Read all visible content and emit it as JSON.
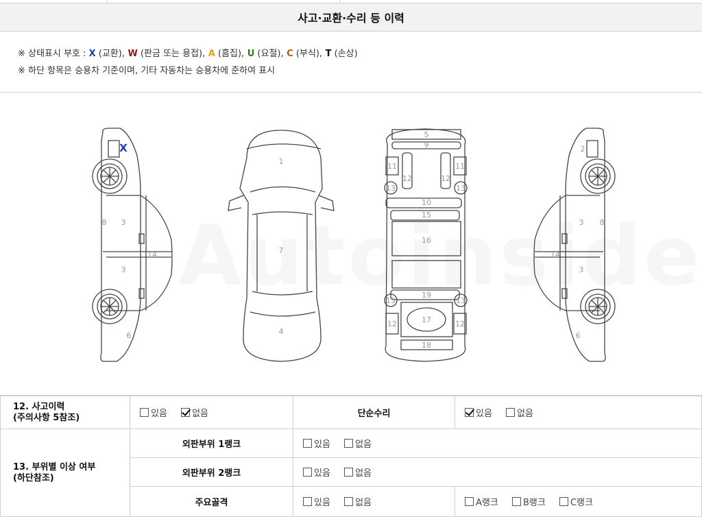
{
  "section_title": "사고·교환·수리 등 이력",
  "legend": {
    "line1_prefix": "※ 상태표시 부호 :",
    "symbols": [
      {
        "code": "X",
        "desc": "(교환),",
        "color": "#1a3fb5"
      },
      {
        "code": "W",
        "desc": "(판금 또는 용접),",
        "color": "#8b1a1a"
      },
      {
        "code": "A",
        "desc": "(흠집),",
        "color": "#e0a400"
      },
      {
        "code": "U",
        "desc": "(요철),",
        "color": "#2a7a1a"
      },
      {
        "code": "C",
        "desc": "(부식),",
        "color": "#b05a00"
      },
      {
        "code": "T",
        "desc": "(손상)",
        "color": "#111111"
      }
    ],
    "line2": "※ 하단 항목은 승용차 기준이며, 기타 자동차는 승용차에 준하여 표시"
  },
  "diagram": {
    "marker_x": "X",
    "marker_color": "#1a3fb5",
    "watermark": "Autoinside",
    "part_numbers": [
      "1",
      "2",
      "3",
      "4",
      "5",
      "6",
      "7",
      "8",
      "9",
      "10",
      "11",
      "12",
      "13",
      "14",
      "15",
      "16",
      "17",
      "18",
      "19"
    ]
  },
  "rows": {
    "accident": {
      "label_line1": "12. 사고이력",
      "label_line2": "(주의사항 5참조)",
      "options": [
        {
          "label": "있음",
          "checked": false
        },
        {
          "label": "없음",
          "checked": true
        }
      ],
      "simple_repair_label": "단순수리",
      "simple_repair_options": [
        {
          "label": "있음",
          "checked": true
        },
        {
          "label": "없음",
          "checked": false
        }
      ]
    },
    "parts": {
      "label_line1": "13. 부위별 이상 여부",
      "label_line2": "(하단참조)",
      "sub": [
        {
          "label": "외판부위 1랭크",
          "options": [
            {
              "label": "있음",
              "checked": false
            },
            {
              "label": "없음",
              "checked": false
            }
          ]
        },
        {
          "label": "외판부위 2랭크",
          "options": [
            {
              "label": "있음",
              "checked": false
            },
            {
              "label": "없음",
              "checked": false
            }
          ]
        },
        {
          "label": "주요골격",
          "options": [
            {
              "label": "있음",
              "checked": false
            },
            {
              "label": "없음",
              "checked": false
            }
          ],
          "ranks": [
            {
              "label": "A랭크",
              "checked": false
            },
            {
              "label": "B랭크",
              "checked": false
            },
            {
              "label": "C랭크",
              "checked": false
            }
          ]
        }
      ]
    }
  }
}
